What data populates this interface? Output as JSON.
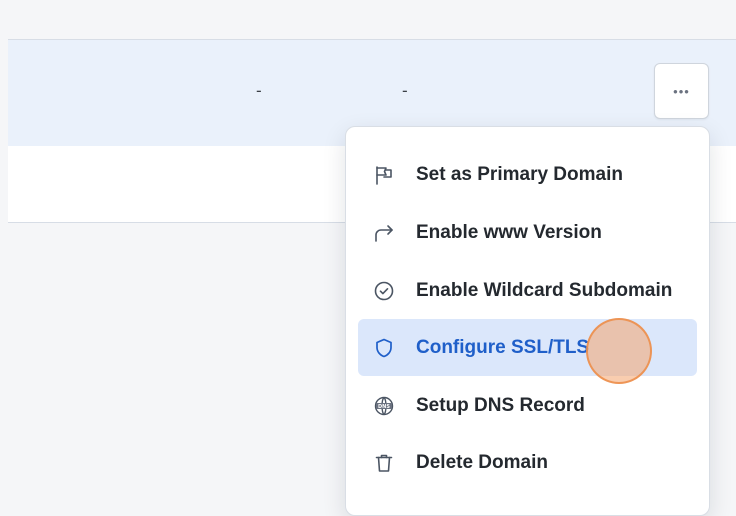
{
  "table": {
    "row": {
      "col_a": "-",
      "col_b": "-"
    },
    "more_button_label": "•••"
  },
  "menu": {
    "items": [
      {
        "label": "Set as Primary Domain",
        "icon": "flag-icon",
        "active": false
      },
      {
        "label": "Enable www Version",
        "icon": "redirect-arrow-icon",
        "active": false
      },
      {
        "label": "Enable Wildcard Subdomain",
        "icon": "check-circle-icon",
        "active": false
      },
      {
        "label": "Configure SSL/TLS",
        "icon": "shield-icon",
        "active": true
      },
      {
        "label": "Setup DNS Record",
        "icon": "dns-globe-icon",
        "active": false
      },
      {
        "label": "Delete Domain",
        "icon": "trash-icon",
        "active": false
      }
    ]
  },
  "colors": {
    "accent": "#1f5fc9",
    "active_bg": "#dbe7fb",
    "row_highlight": "#eaf1fb",
    "cursor": "#f4a46e"
  }
}
